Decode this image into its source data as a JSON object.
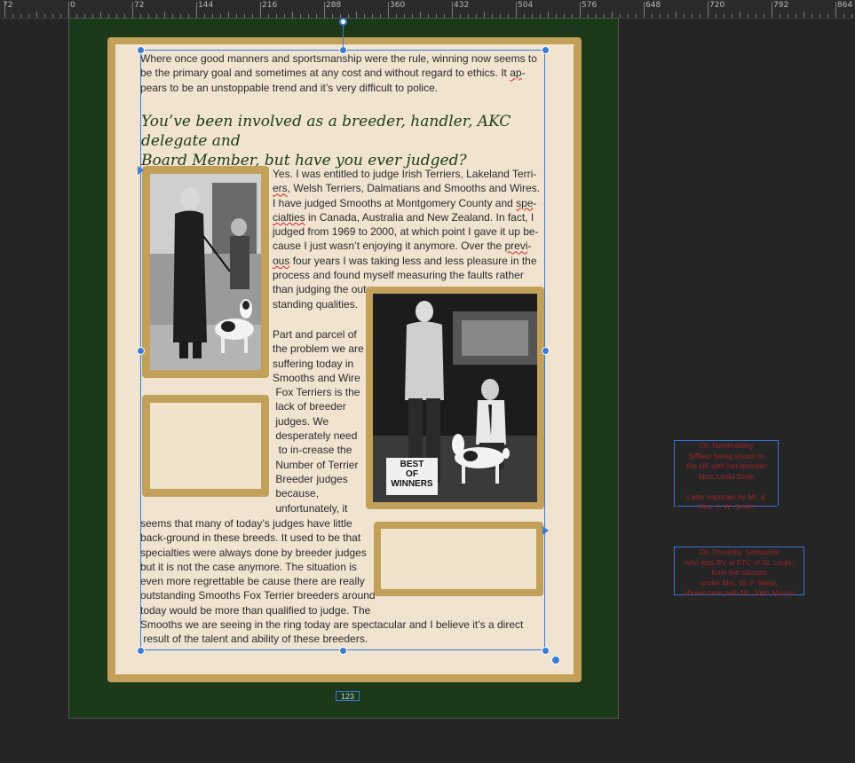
{
  "ruler": {
    "labels": [
      "72",
      "0",
      "72",
      "144",
      "216",
      "288",
      "360",
      "432",
      "504",
      "576",
      "648",
      "720",
      "792",
      "864"
    ]
  },
  "page": {
    "intro_lines": [
      "Where once good manners and sportsmanship were the rule, winning now seems to",
      "be the primary goal and sometimes at any cost and without regard to ethics. It ap-",
      "pears to be an unstoppable trend and it’s very difficult to police."
    ],
    "heading_lines": [
      "You’ve been involved as a breeder, handler, AKC delegate and",
      "Board Member, but have you ever judged?"
    ],
    "answer_lines": [
      "Yes. I was entitled to judge Irish Terriers, Lakeland Terri-",
      "ers, Welsh Terriers, Dalmatians and Smooths and Wires.",
      "I have judged Smooths at Montgomery County and spe-",
      "cialties in Canada, Australia and New Zealand. In fact, I",
      "judged from 1969 to 2000, at which point I gave it up be-",
      "cause I just wasn’t enjoying it anymore. Over the previ-",
      "ous four years I was taking less and less pleasure in the",
      "process and found myself measuring the faults rather",
      "than judging the out-",
      "standing qualities."
    ],
    "part_lines": [
      "Part and parcel of",
      "the problem we are",
      "suffering today in",
      "Smooths and Wire",
      " Fox Terriers is the",
      " lack of breeder",
      " judges. We",
      " desperately need",
      "  to in-crease the",
      " Number of Terrier",
      " Breeder judges",
      " because,",
      " unfortunately, it"
    ],
    "bottom_lines": [
      "seems that many of today’s judges have little",
      "back-ground in these breeds. It used to be that",
      "specialties were always done by breeder judges",
      "but it is not the case anymore. The situation is",
      "even more regrettable be cause there are really",
      "outstanding Smooths Fox Terrier breeders around",
      "today would be more than qualified to judge. The"
    ],
    "last_lines": [
      "Smooths we are seeing in the ring today are spectacular and I believe it’s a direct",
      " result of the talent and ability of these breeders."
    ],
    "page_number": "123",
    "sign_text": [
      "BEST",
      "OF",
      "WINNERS"
    ]
  },
  "captions": {
    "first": [
      "Ch. Newmaidley",
      "Siffleur being shown in",
      "the UK with her breeder",
      "Miss Linda Beak",
      "",
      "Later imported by Mr. &",
      "Mrs. J. W. Smith"
    ],
    "second": [
      "Ch. Dovenby Semaphor",
      "who was BV at FTC of St. Louis,",
      "from the classes",
      "under Mrs. W. P. Wear,",
      "shown here with Mr. John Marvin"
    ]
  },
  "colors": {
    "background": "#1c3a1a",
    "frame": "#c3a05a",
    "paper": "#f0e4d0",
    "selection": "#3a7bd5",
    "caption_text": "#9a2525"
  }
}
